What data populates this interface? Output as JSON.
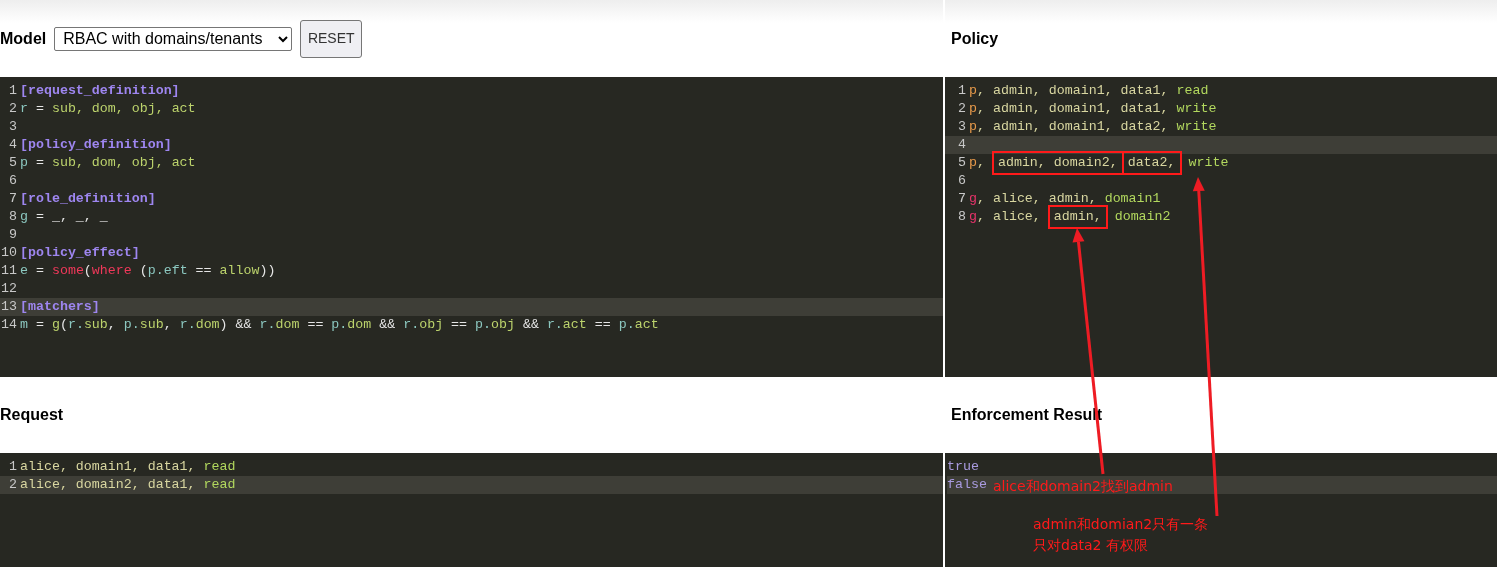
{
  "model": {
    "label": "Model",
    "select": {
      "value": "RBAC with domains/tenants"
    },
    "reset": "RESET",
    "lines": [
      {
        "number": "1",
        "active": false,
        "tokens": [
          {
            "text": "[request_definition]",
            "kind": "section"
          }
        ]
      },
      {
        "number": "2",
        "active": false,
        "tokens": [
          {
            "text": "r",
            "kind": "ident"
          },
          {
            "text": " = ",
            "kind": "op"
          },
          {
            "text": "sub, dom, obj, act",
            "kind": "value"
          }
        ]
      },
      {
        "number": "3",
        "active": false
      },
      {
        "number": "4",
        "active": false,
        "tokens": [
          {
            "text": "[policy_definition]",
            "kind": "section"
          }
        ]
      },
      {
        "number": "5",
        "active": false,
        "tokens": [
          {
            "text": "p",
            "kind": "ident"
          },
          {
            "text": " = ",
            "kind": "op"
          },
          {
            "text": "sub, dom, obj, act",
            "kind": "value"
          }
        ]
      },
      {
        "number": "6",
        "active": false
      },
      {
        "number": "7",
        "active": false,
        "tokens": [
          {
            "text": "[role_definition]",
            "kind": "section"
          }
        ]
      },
      {
        "number": "8",
        "active": false,
        "tokens": [
          {
            "text": "g",
            "kind": "ident"
          },
          {
            "text": " = _, _, _",
            "kind": "op"
          }
        ]
      },
      {
        "number": "9",
        "active": false
      },
      {
        "number": "10",
        "active": false,
        "tokens": [
          {
            "text": "[policy_effect]",
            "kind": "section"
          }
        ]
      },
      {
        "number": "11",
        "active": false,
        "tokens": [
          {
            "text": "e",
            "kind": "ident"
          },
          {
            "text": " = ",
            "kind": "op"
          },
          {
            "text": "some",
            "kind": "func"
          },
          {
            "text": "(",
            "kind": "op"
          },
          {
            "text": "where",
            "kind": "func"
          },
          {
            "text": " (",
            "kind": "op"
          },
          {
            "text": "p.eft",
            "kind": "ident"
          },
          {
            "text": " == ",
            "kind": "op"
          },
          {
            "text": "allow",
            "kind": "value"
          },
          {
            "text": "))",
            "kind": "op"
          }
        ]
      },
      {
        "number": "12",
        "active": false
      },
      {
        "number": "13",
        "active": true,
        "tokens": [
          {
            "text": "[matchers]",
            "kind": "section"
          }
        ]
      },
      {
        "number": "14",
        "active": false,
        "tokens": [
          {
            "text": "m",
            "kind": "ident"
          },
          {
            "text": " = ",
            "kind": "op"
          },
          {
            "text": "g",
            "kind": "value"
          },
          {
            "text": "(",
            "kind": "op"
          },
          {
            "text": "r.",
            "kind": "ident"
          },
          {
            "text": "sub",
            "kind": "value"
          },
          {
            "text": ", ",
            "kind": "op"
          },
          {
            "text": "p.",
            "kind": "ident"
          },
          {
            "text": "sub",
            "kind": "value"
          },
          {
            "text": ", ",
            "kind": "op"
          },
          {
            "text": "r.",
            "kind": "ident"
          },
          {
            "text": "dom",
            "kind": "value"
          },
          {
            "text": ") && ",
            "kind": "op"
          },
          {
            "text": "r.",
            "kind": "ident"
          },
          {
            "text": "dom",
            "kind": "value"
          },
          {
            "text": " == ",
            "kind": "op"
          },
          {
            "text": "p.",
            "kind": "ident"
          },
          {
            "text": "dom",
            "kind": "value"
          },
          {
            "text": " && ",
            "kind": "op"
          },
          {
            "text": "r.",
            "kind": "ident"
          },
          {
            "text": "obj",
            "kind": "value"
          },
          {
            "text": " == ",
            "kind": "op"
          },
          {
            "text": "p.",
            "kind": "ident"
          },
          {
            "text": "obj",
            "kind": "value"
          },
          {
            "text": " && ",
            "kind": "op"
          },
          {
            "text": "r.",
            "kind": "ident"
          },
          {
            "text": "act",
            "kind": "value"
          },
          {
            "text": " == ",
            "kind": "op"
          },
          {
            "text": "p.",
            "kind": "ident"
          },
          {
            "text": "act",
            "kind": "value"
          }
        ]
      }
    ]
  },
  "policy": {
    "label": "Policy",
    "lines": [
      {
        "number": "1",
        "active": false,
        "tokens": [
          {
            "text": "p",
            "kind": "ptype"
          },
          {
            "text": ", admin, domain1, data1, ",
            "kind": "text"
          },
          {
            "text": "read",
            "kind": "action"
          }
        ]
      },
      {
        "number": "2",
        "active": false,
        "tokens": [
          {
            "text": "p",
            "kind": "ptype"
          },
          {
            "text": ", admin, domain1, data1, ",
            "kind": "text"
          },
          {
            "text": "write",
            "kind": "action"
          }
        ]
      },
      {
        "number": "3",
        "active": false,
        "tokens": [
          {
            "text": "p",
            "kind": "ptype"
          },
          {
            "text": ", admin, domain1, data2, ",
            "kind": "text"
          },
          {
            "text": "write",
            "kind": "action"
          }
        ]
      },
      {
        "number": "4",
        "active": true
      },
      {
        "number": "5",
        "active": false,
        "tokens": [
          {
            "text": "p",
            "kind": "ptype"
          },
          {
            "text": ", ",
            "kind": "text"
          },
          {
            "text": "admin, domain2,",
            "kind": "text",
            "boxed": true
          },
          {
            "text": "data2,",
            "kind": "text",
            "boxed": true
          },
          {
            "text": " write",
            "kind": "action"
          }
        ]
      },
      {
        "number": "6",
        "active": false
      },
      {
        "number": "7",
        "active": false,
        "tokens": [
          {
            "text": "g",
            "kind": "gtype"
          },
          {
            "text": ", alice, admin, ",
            "kind": "text"
          },
          {
            "text": "domain1",
            "kind": "action"
          }
        ]
      },
      {
        "number": "8",
        "active": false,
        "tokens": [
          {
            "text": "g",
            "kind": "gtype"
          },
          {
            "text": ", alice, ",
            "kind": "text"
          },
          {
            "text": "admin,",
            "kind": "text",
            "boxed": true
          },
          {
            "text": " domain2",
            "kind": "action"
          }
        ]
      }
    ]
  },
  "request": {
    "label": "Request",
    "lines": [
      {
        "number": "1",
        "active": false,
        "tokens": [
          {
            "text": "alice, domain1, data1, ",
            "kind": "text"
          },
          {
            "text": "read",
            "kind": "action"
          }
        ]
      },
      {
        "number": "2",
        "active": true,
        "tokens": [
          {
            "text": "alice, domain2, data1, ",
            "kind": "text"
          },
          {
            "text": "read",
            "kind": "action"
          }
        ]
      }
    ]
  },
  "result": {
    "label": "Enforcement Result",
    "lines": [
      {
        "active": false,
        "tokens": [
          {
            "text": "true",
            "kind": "bool"
          }
        ]
      },
      {
        "active": true,
        "tokens": [
          {
            "text": "false",
            "kind": "bool"
          }
        ]
      }
    ]
  },
  "annotations": [
    {
      "lines": [
        "alice和domain2找到admin"
      ]
    },
    {
      "lines": [
        "admin和domian2只有一条",
        "只对data2 有权限"
      ]
    }
  ]
}
